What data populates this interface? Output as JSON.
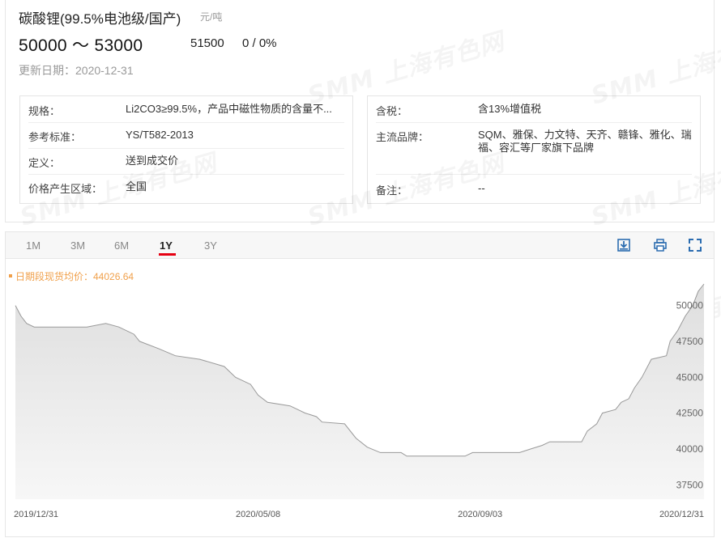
{
  "header": {
    "title": "碳酸锂(99.5%电池级/国产)",
    "unit": "元/吨",
    "price_range": "50000 ～ 53000",
    "average": "51500",
    "change": "0 / 0%",
    "update_date": "更新日期：2020-12-31"
  },
  "specs_left": [
    {
      "key": "规格：",
      "value": "Li2CO3≥99.5%，产品中磁性物质的含量不..."
    },
    {
      "key": "参考标准：",
      "value": "YS/T582-2013"
    },
    {
      "key": "定义：",
      "value": "送到成交价"
    },
    {
      "key": "价格产生区域：",
      "value": "全国"
    }
  ],
  "specs_right": [
    {
      "key": "含税：",
      "value": "含13%增值税"
    },
    {
      "key": "主流品牌：",
      "value": "SQM、雅保、力文特、天齐、赣锋、雅化、瑞福、容汇等厂家旗下品牌"
    },
    {
      "key": "备注：",
      "value": "--"
    }
  ],
  "watermark": "SMM 上海有色网",
  "tabs": [
    "1M",
    "3M",
    "6M",
    "1Y",
    "3Y"
  ],
  "active_tab": "1Y",
  "toolbar": {
    "icons": [
      "download-icon",
      "print-icon",
      "fullscreen-icon"
    ]
  },
  "legend": "日期段现货均价：44026.64",
  "colors": {
    "accent": "#e60012",
    "legend": "#f0a04b",
    "line": "#999999",
    "icon": "#2b6cb0"
  },
  "chart_data": {
    "type": "area",
    "title": "",
    "xlabel": "",
    "ylabel": "",
    "ylim": [
      36500,
      51500
    ],
    "yticks": [
      37500,
      40000,
      42500,
      45000,
      47500,
      50000
    ],
    "y_axis_position": "right",
    "x_tick_labels": [
      "2019/12/31",
      "2020/05/08",
      "2020/09/03",
      "2020/12/31"
    ],
    "x_tick_dates": [
      "2019-12-31",
      "2020-05-08",
      "2020-09-03",
      "2020-12-31"
    ],
    "grid": false,
    "legend": "top-left",
    "series": [
      {
        "name": "",
        "points": [
          [
            "2019-12-31",
            50000
          ],
          [
            "2020-01-03",
            49250
          ],
          [
            "2020-01-06",
            48750
          ],
          [
            "2020-01-10",
            48500
          ],
          [
            "2020-02-07",
            48500
          ],
          [
            "2020-02-17",
            48750
          ],
          [
            "2020-02-24",
            48500
          ],
          [
            "2020-03-03",
            48000
          ],
          [
            "2020-03-06",
            47500
          ],
          [
            "2020-03-16",
            47000
          ],
          [
            "2020-03-25",
            46500
          ],
          [
            "2020-04-07",
            46250
          ],
          [
            "2020-04-20",
            45750
          ],
          [
            "2020-04-26",
            45000
          ],
          [
            "2020-05-04",
            44500
          ],
          [
            "2020-05-08",
            43750
          ],
          [
            "2020-05-13",
            43250
          ],
          [
            "2020-05-25",
            43000
          ],
          [
            "2020-06-02",
            42500
          ],
          [
            "2020-06-08",
            42250
          ],
          [
            "2020-06-11",
            41875
          ],
          [
            "2020-06-23",
            41750
          ],
          [
            "2020-06-29",
            40750
          ],
          [
            "2020-07-05",
            40125
          ],
          [
            "2020-07-12",
            39750
          ],
          [
            "2020-07-23",
            39750
          ],
          [
            "2020-07-26",
            39500
          ],
          [
            "2020-08-26",
            39500
          ],
          [
            "2020-08-30",
            39750
          ],
          [
            "2020-09-24",
            39750
          ],
          [
            "2020-09-30",
            40000
          ],
          [
            "2020-10-06",
            40250
          ],
          [
            "2020-10-10",
            40500
          ],
          [
            "2020-10-27",
            40500
          ],
          [
            "2020-10-30",
            41250
          ],
          [
            "2020-11-04",
            41750
          ],
          [
            "2020-11-07",
            42500
          ],
          [
            "2020-11-14",
            42750
          ],
          [
            "2020-11-17",
            43250
          ],
          [
            "2020-11-21",
            43500
          ],
          [
            "2020-11-24",
            44250
          ],
          [
            "2020-11-28",
            45000
          ],
          [
            "2020-12-03",
            46250
          ],
          [
            "2020-12-11",
            46500
          ],
          [
            "2020-12-13",
            47500
          ],
          [
            "2020-12-17",
            48250
          ],
          [
            "2020-12-21",
            49250
          ],
          [
            "2020-12-25",
            50000
          ],
          [
            "2020-12-28",
            51000
          ],
          [
            "2020-12-31",
            51500
          ]
        ]
      }
    ]
  }
}
